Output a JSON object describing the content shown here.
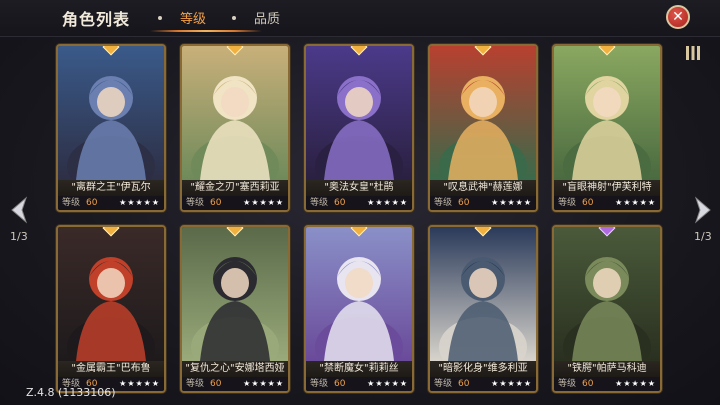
{
  "header": {
    "title": "角色列表",
    "tabs": [
      {
        "label": "等级",
        "active": true
      },
      {
        "label": "品质",
        "active": false
      }
    ],
    "close_icon": "close-icon"
  },
  "pagination": {
    "left": "1/3",
    "right": "1/3"
  },
  "heroes": [
    {
      "name": "\"离群之王\"伊瓦尔",
      "level_label": "等级",
      "level": "60",
      "stars": "★★★★★",
      "gem": "gold",
      "palette": [
        "#3a5a8a",
        "#6b7fb0",
        "#2d2f45"
      ]
    },
    {
      "name": "\"耀金之刃\"塞西莉亚",
      "level_label": "等级",
      "level": "60",
      "stars": "★★★★★",
      "gem": "gold",
      "palette": [
        "#c9b07a",
        "#f0e4c4",
        "#6f8a5a"
      ]
    },
    {
      "name": "\"奥法女皇\"杜鹃",
      "level_label": "等级",
      "level": "60",
      "stars": "★★★★★",
      "gem": "gold",
      "palette": [
        "#4b3a8a",
        "#8a70c8",
        "#2a2040"
      ]
    },
    {
      "name": "\"叹息武神\"赫莲娜",
      "level_label": "等级",
      "level": "60",
      "stars": "★★★★★",
      "gem": "gold",
      "palette": [
        "#b84030",
        "#e8b060",
        "#3a6a4a"
      ]
    },
    {
      "name": "\"盲眼神射\"伊芙利特",
      "level_label": "等级",
      "level": "60",
      "stars": "★★★★★",
      "gem": "gold",
      "palette": [
        "#8aa860",
        "#e0d4a0",
        "#4a6a40"
      ]
    },
    {
      "name": "\"金属霸王\"巴布鲁",
      "level_label": "等级",
      "level": "60",
      "stars": "★★★★★",
      "gem": "gold",
      "palette": [
        "#3a2a28",
        "#c0402a",
        "#1e1a1c"
      ]
    },
    {
      "name": "\"复仇之心\"安娜塔西娅",
      "level_label": "等级",
      "level": "60",
      "stars": "★★★★★",
      "gem": "gold",
      "palette": [
        "#5a6a4a",
        "#2a2a30",
        "#9aaa7a"
      ]
    },
    {
      "name": "\"禁断魔女\"莉莉丝",
      "level_label": "等级",
      "level": "60",
      "stars": "★★★★★",
      "gem": "gold",
      "palette": [
        "#8a90c8",
        "#e8e4f0",
        "#6a4a9a"
      ]
    },
    {
      "name": "\"暗影化身\"维多利亚",
      "level_label": "等级",
      "level": "60",
      "stars": "★★★★★",
      "gem": "gold",
      "palette": [
        "#2a3a5a",
        "#4a5a70",
        "#d8d4cc"
      ]
    },
    {
      "name": "\"铁腭\"帕萨马科迪",
      "level_label": "等级",
      "level": "60",
      "stars": "★★★★★",
      "gem": "purple",
      "palette": [
        "#4a5a3a",
        "#7a8a5a",
        "#2a3020"
      ]
    }
  ],
  "footer": {
    "version": "Z.4.8 (1133106)"
  }
}
